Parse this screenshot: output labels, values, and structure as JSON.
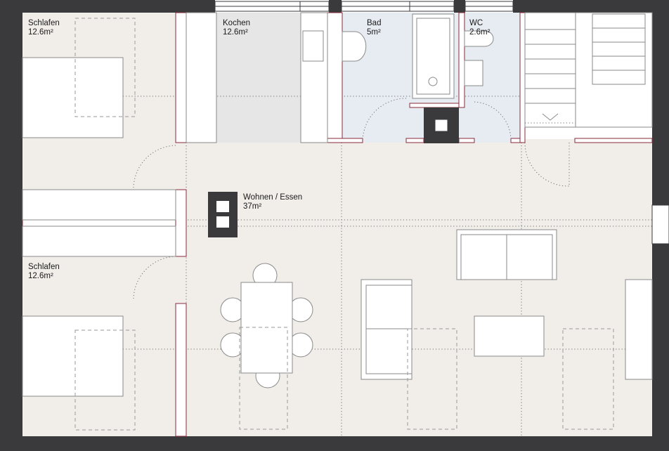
{
  "rooms": [
    {
      "name": "Schlafen",
      "area": "12.6m²"
    },
    {
      "name": "Kochen",
      "area": "12.6m²"
    },
    {
      "name": "Bad",
      "area": "5m²"
    },
    {
      "name": "WC",
      "area": "2.6m²"
    },
    {
      "name": "Wohnen / Essen",
      "area": "37m²"
    },
    {
      "name": "Schlafen",
      "area": "12.6m²"
    }
  ],
  "colors": {
    "wall": "#3a3a3c",
    "floor": "#f1eeea",
    "wet_room": "#e7ecf2",
    "kitchen": "#e6e6e6",
    "partition_stroke": "#8a2a3a",
    "furniture_stroke": "#8a8a8a"
  }
}
